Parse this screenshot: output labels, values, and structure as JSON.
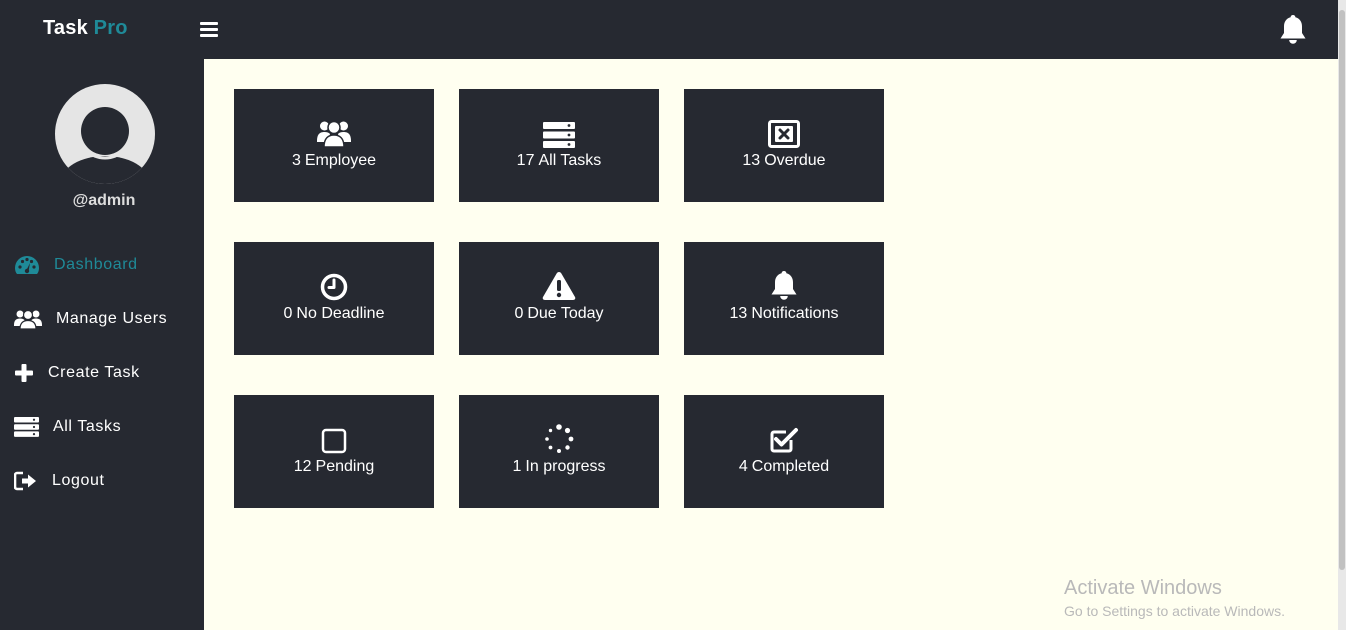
{
  "brand": {
    "name": "Task",
    "accent": "Pro"
  },
  "user": {
    "handle": "@admin"
  },
  "nav": [
    {
      "label": "Dashboard",
      "icon": "dashboard-icon",
      "active": true
    },
    {
      "label": "Manage Users",
      "icon": "users-icon",
      "active": false
    },
    {
      "label": "Create Task",
      "icon": "plus-icon",
      "active": false
    },
    {
      "label": "All Tasks",
      "icon": "tasks-icon",
      "active": false
    },
    {
      "label": "Logout",
      "icon": "logout-icon",
      "active": false
    }
  ],
  "cards": [
    {
      "count": "3",
      "label": "Employee",
      "icon": "users-icon"
    },
    {
      "count": "17",
      "label": "All Tasks",
      "icon": "tasks-icon"
    },
    {
      "count": "13",
      "label": "Overdue",
      "icon": "overdue-icon"
    },
    {
      "count": "0",
      "label": "No Deadline",
      "icon": "clock-icon"
    },
    {
      "count": "0",
      "label": "Due Today",
      "icon": "warning-icon"
    },
    {
      "count": "13",
      "label": "Notifications",
      "icon": "bell-icon"
    },
    {
      "count": "12",
      "label": "Pending",
      "icon": "square-icon"
    },
    {
      "count": "1",
      "label": "In progress",
      "icon": "spinner-icon"
    },
    {
      "count": "4",
      "label": "Completed",
      "icon": "check-square-icon"
    }
  ],
  "watermark": {
    "title": "Activate Windows",
    "subtitle": "Go to Settings to activate Windows."
  },
  "colors": {
    "dark": "#262931",
    "accent": "#1f8a98",
    "content_bg": "#fffff0"
  }
}
